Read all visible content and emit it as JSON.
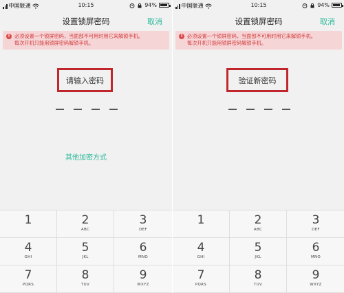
{
  "status": {
    "carrier": "中国联通",
    "time": "10:15",
    "battery": "94%",
    "battery_level": 0.94
  },
  "nav": {
    "title": "设置锁屏密码",
    "cancel": "取消"
  },
  "warning": {
    "line1": "必须设置一个锁屏密码，当面部不可用时用它来解锁手机。",
    "line2": "每次开机只能用锁屏密码解锁手机。"
  },
  "screens": {
    "left": {
      "prompt": "请输入密码",
      "alt_method": "其他加密方式"
    },
    "right": {
      "prompt": "验证新密码"
    }
  },
  "keypad": [
    {
      "num": "1",
      "letters": ""
    },
    {
      "num": "2",
      "letters": "ABC"
    },
    {
      "num": "3",
      "letters": "DEF"
    },
    {
      "num": "4",
      "letters": "GHI"
    },
    {
      "num": "5",
      "letters": "JKL"
    },
    {
      "num": "6",
      "letters": "MNO"
    },
    {
      "num": "7",
      "letters": "PQRS"
    },
    {
      "num": "8",
      "letters": "TUV"
    },
    {
      "num": "9",
      "letters": "WXYZ"
    }
  ],
  "colors": {
    "accent": "#2bb89a",
    "highlight_border": "#c0272d",
    "warning_bg": "#f6d5d7",
    "warning_text": "#d23b3b"
  }
}
